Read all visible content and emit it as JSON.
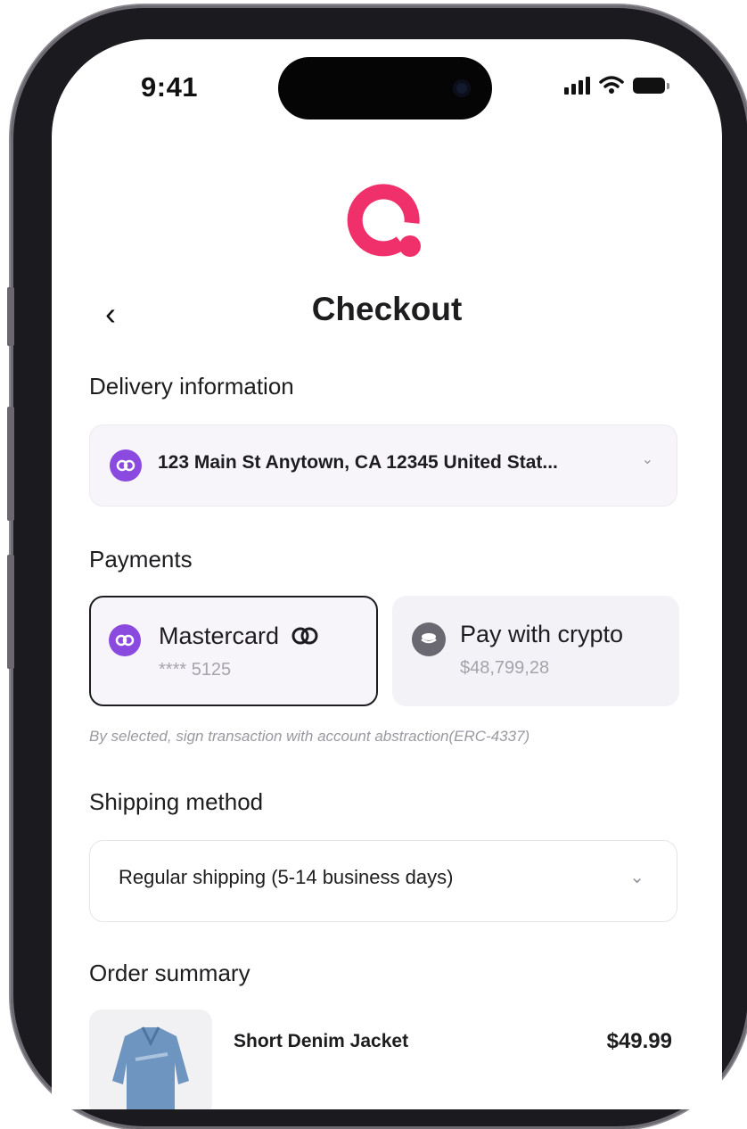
{
  "status_bar": {
    "time": "9:41"
  },
  "header": {
    "back_icon": "‹",
    "title": "Checkout"
  },
  "delivery": {
    "label": "Delivery information",
    "address": "123 Main St Anytown, CA 12345 United Stat...",
    "chevron": "⌄"
  },
  "payments": {
    "label": "Payments",
    "mastercard": {
      "title": "Mastercard",
      "number": "**** 5125"
    },
    "crypto": {
      "title": "Pay with crypto",
      "balance": "$48,799,28"
    },
    "note": "By selected, sign transaction with account abstraction(ERC-4337)"
  },
  "shipping": {
    "label": "Shipping method",
    "selected": "Regular shipping (5-14 business days)",
    "chevron": "⌄"
  },
  "order_summary": {
    "label": "Order summary",
    "items": [
      {
        "name": "Short Denim Jacket",
        "price": "$49.99"
      }
    ]
  },
  "colors": {
    "brand": "#f0306a",
    "accent_purple": "#8a4ae0",
    "text": "#1d1d1f"
  },
  "icons": [
    "app-logo-icon",
    "back-chevron-icon",
    "link-icon",
    "mastercard-icon",
    "crypto-coin-icon",
    "chevron-down-icon"
  ]
}
